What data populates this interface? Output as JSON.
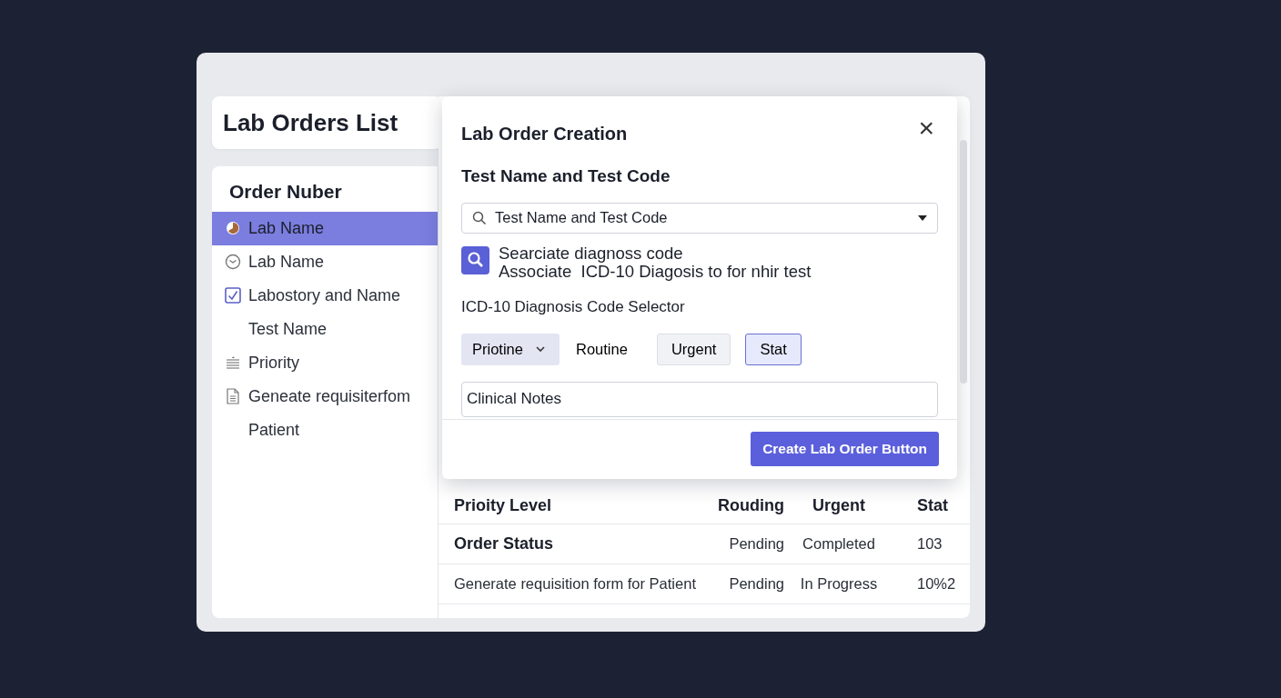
{
  "page_title": "Lab Orders List",
  "sidebar": {
    "heading": "Order Nuber",
    "items": [
      {
        "label": "Lab Name",
        "kind": "pie",
        "selected": true
      },
      {
        "label": "Lab Name",
        "kind": "clock",
        "selected": false
      },
      {
        "label": "Labostory and Name",
        "kind": "checkbox",
        "checked": true,
        "selected": false
      },
      {
        "label": "Test Name",
        "kind": "plain",
        "selected": false
      },
      {
        "label": "Priority",
        "kind": "lines",
        "selected": false
      },
      {
        "label": "Geneate requisiterfom",
        "kind": "document",
        "selected": false
      },
      {
        "label": "Patient",
        "kind": "plain",
        "selected": false
      }
    ]
  },
  "dialog": {
    "title": "Lab Order Creation",
    "close": "×",
    "section_title": "Test Name and Test Code",
    "test_search": {
      "value": "Test Name and Test Code"
    },
    "diagnosis": {
      "line_1": "Searciate diagnoss code",
      "line_2": "Associate  ICD-10 Diagosis to for nhir test"
    },
    "selector_label": "ICD-10 Diagnosis Code Selector",
    "priority_select": "Priotine",
    "priority_options": [
      {
        "label": "Routine",
        "kind": "plain",
        "selected": false
      },
      {
        "label": "Urgent",
        "kind": "button",
        "selected": false
      },
      {
        "label": "Stat",
        "kind": "button",
        "selected": true
      }
    ],
    "notes": {
      "value": "Clinical Notes"
    },
    "submit": "Create Lab Order Button"
  },
  "table": {
    "columns": [
      "Prioity Level",
      "Rouding",
      "Urgent",
      "Stat"
    ],
    "rows": [
      {
        "emphasis": true,
        "cells": [
          "Order Status",
          "Pending",
          "Completed",
          "103"
        ]
      },
      {
        "emphasis": false,
        "cells": [
          "Generate requisition form for Patient",
          "Pending",
          "In Progress",
          "10%2"
        ]
      }
    ]
  }
}
